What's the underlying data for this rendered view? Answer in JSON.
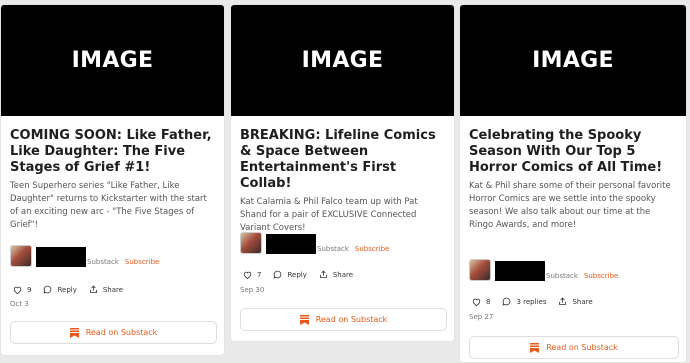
{
  "cards": [
    {
      "image_placeholder": "IMAGE",
      "title": "COMING SOON: Like Father, Like Daughter: The Five Stages of Grief #1!",
      "description": "Teen Superhero series \"Like Father, Like Daughter\" returns to Kickstarter with the start of an exciting new arc - \"The Five Stages of Grief\"!",
      "publisher_label": "Substack",
      "subscribe_label": "Subscribe",
      "likes": "9",
      "reply_label": "Reply",
      "share_label": "Share",
      "date": "Oct 3",
      "read_label": "Read on Substack"
    },
    {
      "image_placeholder": "IMAGE",
      "title": "BREAKING: Lifeline Comics & Space Between Entertainment's First Collab!",
      "description": "Kat Calamia & Phil Falco team up with Pat Shand for a pair of EXCLUSIVE Connected Variant Covers!",
      "publisher_label": "Substack",
      "subscribe_label": "Subscribe",
      "likes": "7",
      "reply_label": "Reply",
      "share_label": "Share",
      "date": "Sep 30",
      "read_label": "Read on Substack"
    },
    {
      "image_placeholder": "IMAGE",
      "title": "Celebrating the Spooky Season With Our Top 5 Horror Comics of All Time!",
      "description": "Kat & Phil share some of their personal favorite Horror Comics are we settle into the spooky season! We also talk about our time at the Ringo Awards, and more!",
      "publisher_label": "Substack",
      "subscribe_label": "Subscribe",
      "likes": "8",
      "reply_label": "3 replies",
      "share_label": "Share",
      "date": "Sep 27",
      "read_label": "Read on Substack"
    }
  ],
  "colors": {
    "accent": "#e8591a",
    "background": "#e9e9e9",
    "card": "#ffffff"
  },
  "icons": {
    "like": "heart-icon",
    "reply": "comment-icon",
    "share": "share-icon",
    "read": "substack-logo-icon"
  }
}
